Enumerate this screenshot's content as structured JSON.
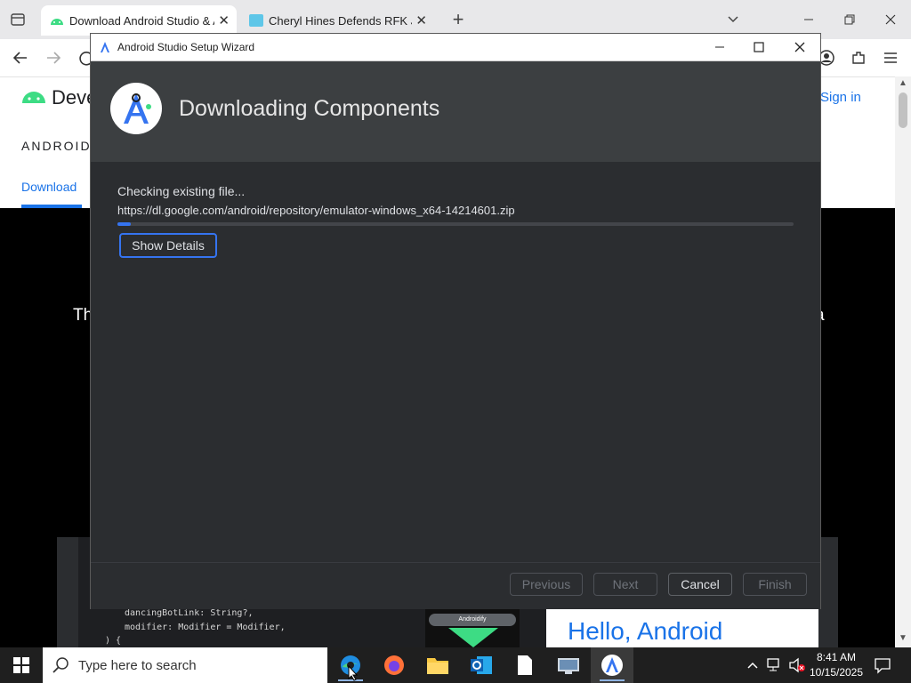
{
  "browser": {
    "tabs": [
      {
        "title": "Download Android Studio & Ap",
        "active": true,
        "favicon": "android-favicon"
      },
      {
        "title": "Cheryl Hines Defends RFK Jr.'s I",
        "active": false,
        "favicon": "news-favicon"
      }
    ],
    "new_tab_glyph": "+",
    "page": {
      "logo_text": "Deve",
      "sign_in": "Sign in",
      "section_label": "ANDROID",
      "nav_download": "Download",
      "hero_left": "Th",
      "hero_right": "a",
      "ide_code_lines": [
        "dancingBotLink: String?,",
        "modifier: Modifier = Modifier,",
        ") {"
      ],
      "ide_preview_label": "Androidify",
      "hello_text": "Hello, Android"
    }
  },
  "wizard": {
    "window_title": "Android Studio Setup Wizard",
    "heading": "Downloading Components",
    "status": "Checking existing file...",
    "url": "https://dl.google.com/android/repository/emulator-windows_x64-14214601.zip",
    "progress": 0.02,
    "show_details": "Show Details",
    "buttons": {
      "previous": "Previous",
      "next": "Next",
      "cancel": "Cancel",
      "finish": "Finish"
    }
  },
  "taskbar": {
    "search_placeholder": "Type here to search",
    "time": "8:41 AM",
    "date": "10/15/2025"
  },
  "colors": {
    "accent_blue": "#3574f0",
    "android_green": "#3ddc84",
    "dialog_bg": "#2b2d30",
    "header_bg": "#3c3f41"
  }
}
